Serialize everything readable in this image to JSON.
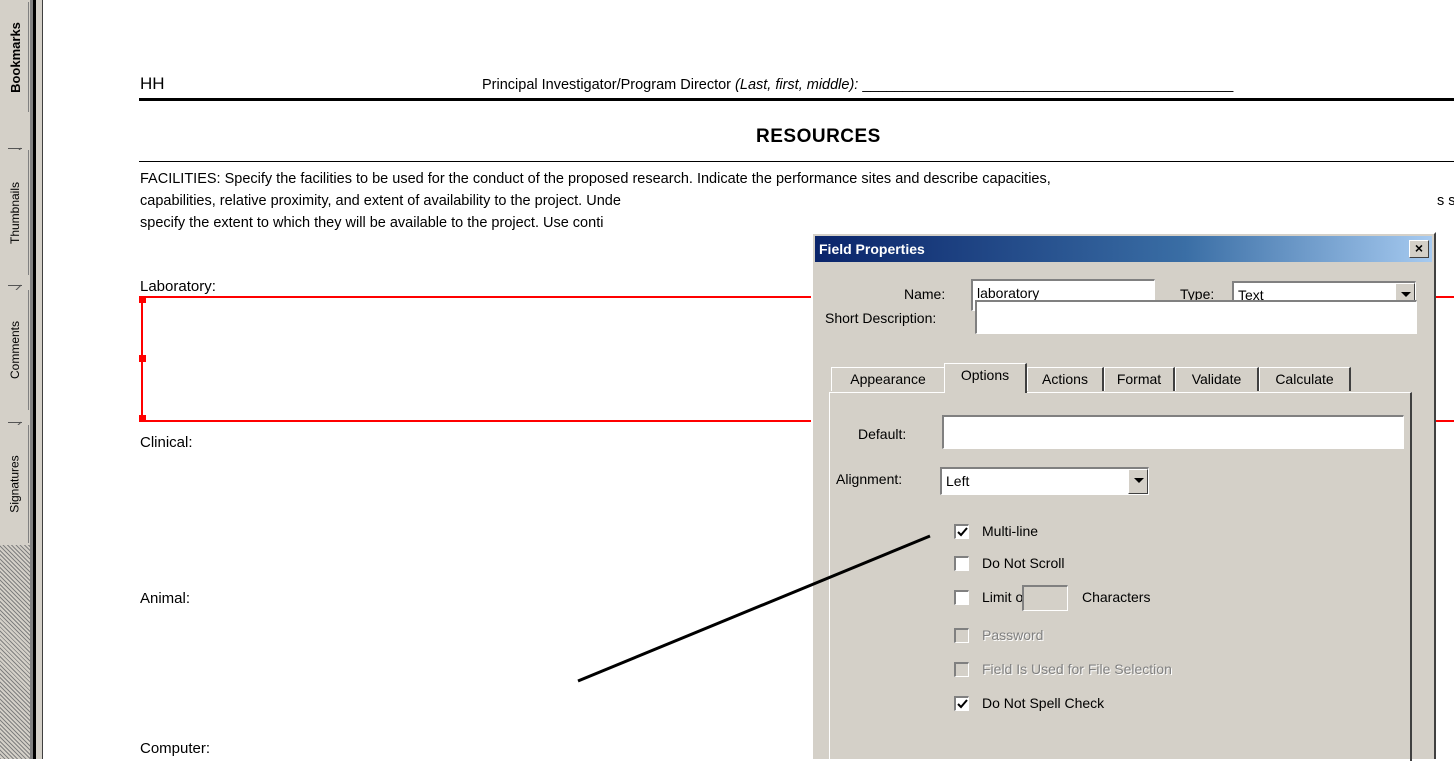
{
  "nav": {
    "tabs": [
      {
        "label": "Bookmarks",
        "active": true
      },
      {
        "label": "Thumbnails",
        "active": false
      },
      {
        "label": "Comments",
        "active": false
      },
      {
        "label": "Signatures",
        "active": false
      }
    ]
  },
  "document": {
    "header_left": "HH",
    "pi_label": "Principal Investigator/Program Director ",
    "pi_hint": "(Last, first, middle):",
    "pi_blank": " ______________________________________________",
    "section_title": "RESOURCES",
    "facilities_lines": [
      "FACILITIES:  Specify the facilities to be used for the conduct of the proposed research. Indicate the performance sites and describe capacities,",
      "capabilities, relative proximity, and extent of availability to the project. Unde",
      "specify the extent to which they will be available to the project. Use conti"
    ],
    "facilities_overflow": "s s",
    "labels": {
      "laboratory": "Laboratory:",
      "clinical": "Clinical:",
      "animal": "Animal:",
      "computer": "Computer:"
    }
  },
  "dialog": {
    "title": "Field Properties",
    "close_glyph": "×",
    "name_label": "Name:",
    "name_value": "laboratory",
    "type_label": "Type:",
    "type_value": "Text",
    "short_desc_label": "Short Description:",
    "short_desc_value": "",
    "tabs": [
      "Appearance",
      "Options",
      "Actions",
      "Format",
      "Validate",
      "Calculate"
    ],
    "active_tab": "Options",
    "default_label": "Default:",
    "default_value": "",
    "alignment_label": "Alignment:",
    "alignment_value": "Left",
    "options": {
      "multiline": {
        "label": "Multi-line",
        "checked": true,
        "enabled": true
      },
      "do_not_scroll": {
        "label": "Do Not Scroll",
        "checked": false,
        "enabled": true
      },
      "limit_of": {
        "label": "Limit of",
        "after": "Characters",
        "checked": false,
        "enabled": true,
        "value": ""
      },
      "password": {
        "label": "Password",
        "checked": false,
        "enabled": false
      },
      "file_selection": {
        "label": "Field Is Used for File Selection",
        "checked": false,
        "enabled": false
      },
      "do_not_spell_check": {
        "label": "Do Not Spell Check",
        "checked": true,
        "enabled": true
      }
    }
  },
  "colors": {
    "field_border": "#ff0000",
    "titlebar_start": "#0a246a",
    "dialog_face": "#d4d0c8"
  }
}
